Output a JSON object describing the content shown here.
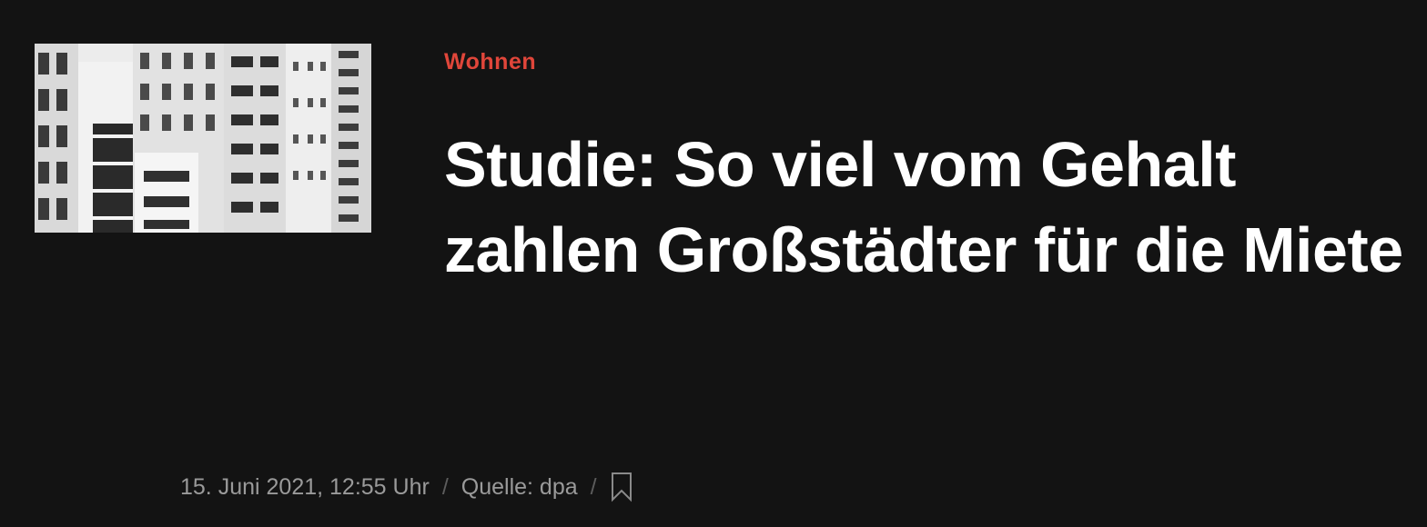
{
  "article": {
    "kicker": "Wohnen",
    "headline": "Studie: So viel vom Gehalt zahlen Großstädter für die Miete",
    "image": {
      "alt": "Apartment buildings"
    },
    "meta": {
      "date": "15. Juni 2021, 12:55 Uhr",
      "separator": "/",
      "source": "Quelle: dpa"
    },
    "bookmark_icon": "bookmark-icon"
  },
  "colors": {
    "background": "#131313",
    "kicker": "#e0463a",
    "headline": "#ffffff",
    "meta": "#9a9a9a"
  }
}
